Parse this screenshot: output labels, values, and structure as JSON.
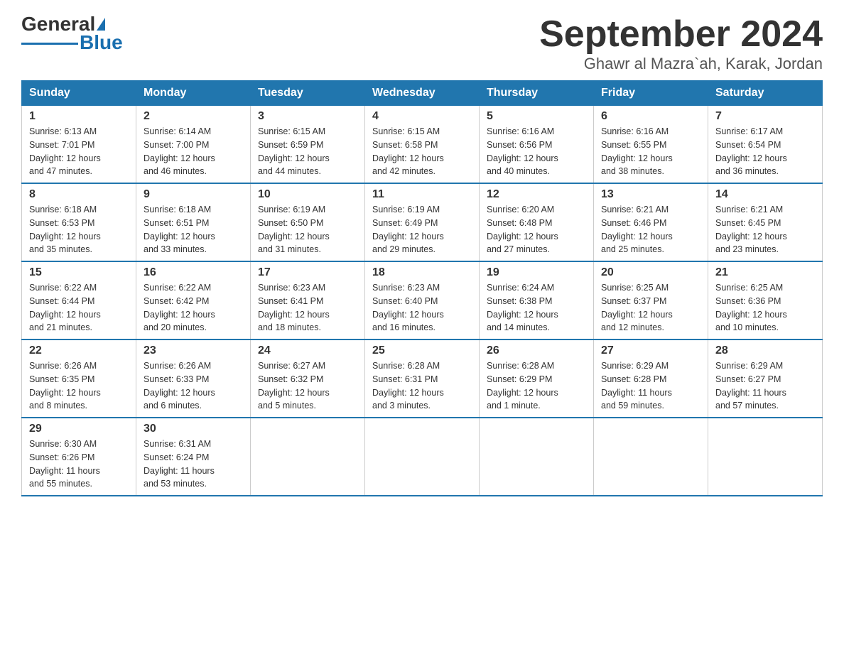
{
  "logo": {
    "text_general": "General",
    "text_blue": "Blue"
  },
  "title": "September 2024",
  "subtitle": "Ghawr al Mazra`ah, Karak, Jordan",
  "days_header": [
    "Sunday",
    "Monday",
    "Tuesday",
    "Wednesday",
    "Thursday",
    "Friday",
    "Saturday"
  ],
  "weeks": [
    [
      {
        "day": "1",
        "sunrise": "6:13 AM",
        "sunset": "7:01 PM",
        "daylight": "12 hours and 47 minutes."
      },
      {
        "day": "2",
        "sunrise": "6:14 AM",
        "sunset": "7:00 PM",
        "daylight": "12 hours and 46 minutes."
      },
      {
        "day": "3",
        "sunrise": "6:15 AM",
        "sunset": "6:59 PM",
        "daylight": "12 hours and 44 minutes."
      },
      {
        "day": "4",
        "sunrise": "6:15 AM",
        "sunset": "6:58 PM",
        "daylight": "12 hours and 42 minutes."
      },
      {
        "day": "5",
        "sunrise": "6:16 AM",
        "sunset": "6:56 PM",
        "daylight": "12 hours and 40 minutes."
      },
      {
        "day": "6",
        "sunrise": "6:16 AM",
        "sunset": "6:55 PM",
        "daylight": "12 hours and 38 minutes."
      },
      {
        "day": "7",
        "sunrise": "6:17 AM",
        "sunset": "6:54 PM",
        "daylight": "12 hours and 36 minutes."
      }
    ],
    [
      {
        "day": "8",
        "sunrise": "6:18 AM",
        "sunset": "6:53 PM",
        "daylight": "12 hours and 35 minutes."
      },
      {
        "day": "9",
        "sunrise": "6:18 AM",
        "sunset": "6:51 PM",
        "daylight": "12 hours and 33 minutes."
      },
      {
        "day": "10",
        "sunrise": "6:19 AM",
        "sunset": "6:50 PM",
        "daylight": "12 hours and 31 minutes."
      },
      {
        "day": "11",
        "sunrise": "6:19 AM",
        "sunset": "6:49 PM",
        "daylight": "12 hours and 29 minutes."
      },
      {
        "day": "12",
        "sunrise": "6:20 AM",
        "sunset": "6:48 PM",
        "daylight": "12 hours and 27 minutes."
      },
      {
        "day": "13",
        "sunrise": "6:21 AM",
        "sunset": "6:46 PM",
        "daylight": "12 hours and 25 minutes."
      },
      {
        "day": "14",
        "sunrise": "6:21 AM",
        "sunset": "6:45 PM",
        "daylight": "12 hours and 23 minutes."
      }
    ],
    [
      {
        "day": "15",
        "sunrise": "6:22 AM",
        "sunset": "6:44 PM",
        "daylight": "12 hours and 21 minutes."
      },
      {
        "day": "16",
        "sunrise": "6:22 AM",
        "sunset": "6:42 PM",
        "daylight": "12 hours and 20 minutes."
      },
      {
        "day": "17",
        "sunrise": "6:23 AM",
        "sunset": "6:41 PM",
        "daylight": "12 hours and 18 minutes."
      },
      {
        "day": "18",
        "sunrise": "6:23 AM",
        "sunset": "6:40 PM",
        "daylight": "12 hours and 16 minutes."
      },
      {
        "day": "19",
        "sunrise": "6:24 AM",
        "sunset": "6:38 PM",
        "daylight": "12 hours and 14 minutes."
      },
      {
        "day": "20",
        "sunrise": "6:25 AM",
        "sunset": "6:37 PM",
        "daylight": "12 hours and 12 minutes."
      },
      {
        "day": "21",
        "sunrise": "6:25 AM",
        "sunset": "6:36 PM",
        "daylight": "12 hours and 10 minutes."
      }
    ],
    [
      {
        "day": "22",
        "sunrise": "6:26 AM",
        "sunset": "6:35 PM",
        "daylight": "12 hours and 8 minutes."
      },
      {
        "day": "23",
        "sunrise": "6:26 AM",
        "sunset": "6:33 PM",
        "daylight": "12 hours and 6 minutes."
      },
      {
        "day": "24",
        "sunrise": "6:27 AM",
        "sunset": "6:32 PM",
        "daylight": "12 hours and 5 minutes."
      },
      {
        "day": "25",
        "sunrise": "6:28 AM",
        "sunset": "6:31 PM",
        "daylight": "12 hours and 3 minutes."
      },
      {
        "day": "26",
        "sunrise": "6:28 AM",
        "sunset": "6:29 PM",
        "daylight": "12 hours and 1 minute."
      },
      {
        "day": "27",
        "sunrise": "6:29 AM",
        "sunset": "6:28 PM",
        "daylight": "11 hours and 59 minutes."
      },
      {
        "day": "28",
        "sunrise": "6:29 AM",
        "sunset": "6:27 PM",
        "daylight": "11 hours and 57 minutes."
      }
    ],
    [
      {
        "day": "29",
        "sunrise": "6:30 AM",
        "sunset": "6:26 PM",
        "daylight": "11 hours and 55 minutes."
      },
      {
        "day": "30",
        "sunrise": "6:31 AM",
        "sunset": "6:24 PM",
        "daylight": "11 hours and 53 minutes."
      },
      null,
      null,
      null,
      null,
      null
    ]
  ]
}
